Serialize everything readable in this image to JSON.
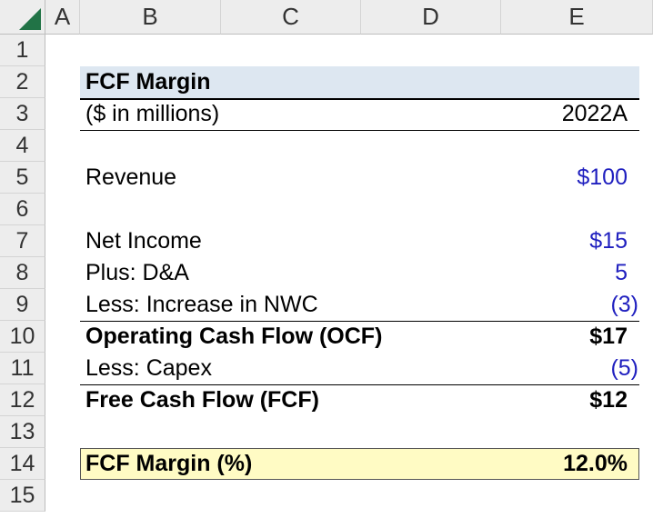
{
  "sheet": {
    "columns": [
      "A",
      "B",
      "C",
      "D",
      "E"
    ],
    "rows": [
      "1",
      "2",
      "3",
      "4",
      "5",
      "6",
      "7",
      "8",
      "9",
      "10",
      "11",
      "12",
      "13",
      "14",
      "15"
    ]
  },
  "table": {
    "title": "FCF Margin",
    "units": "($ in millions)",
    "period": "2022A",
    "revenue": {
      "label": "Revenue",
      "value": "$100"
    },
    "net_income": {
      "label": "Net Income",
      "value": "$15"
    },
    "plus_da": {
      "label": "Plus: D&A",
      "value": "5"
    },
    "less_nwc": {
      "label": "Less: Increase in NWC",
      "value": "(3)"
    },
    "ocf": {
      "label": "Operating Cash Flow (OCF)",
      "value": "$17"
    },
    "less_capex": {
      "label": "Less: Capex",
      "value": "(5)"
    },
    "fcf": {
      "label": "Free Cash Flow (FCF)",
      "value": "$12"
    },
    "fcf_margin": {
      "label": "FCF Margin (%)",
      "value": "12.0%"
    }
  },
  "colors": {
    "input_blue": "#1f1fbf",
    "title_band": "#dde7f1",
    "margin_band": "#fffbc4",
    "excel_green": "#217346"
  }
}
